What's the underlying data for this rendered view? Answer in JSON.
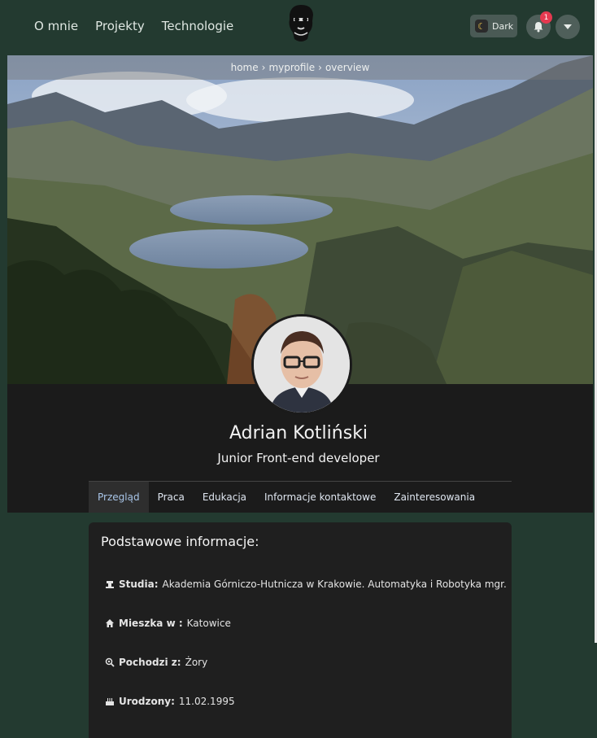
{
  "nav": {
    "links": [
      "O mnie",
      "Projekty",
      "Technologie"
    ],
    "theme_label": "Dark",
    "notification_count": "1"
  },
  "breadcrumb": [
    "home",
    "myprofile",
    "overview"
  ],
  "profile": {
    "name": "Adrian Kotliński",
    "role": "Junior Front-end developer"
  },
  "tabs": [
    "Przegląd",
    "Praca",
    "Edukacja",
    "Informacje kontaktowe",
    "Zainteresowania"
  ],
  "active_tab": "Przegląd",
  "info": {
    "title": "Podstawowe informacje:",
    "rows": [
      {
        "icon": "graduation-icon",
        "key": "Studia:",
        "value": "Akademia Górniczo-Hutnicza w Krakowie. Automatyka i Robotyka mgr."
      },
      {
        "icon": "home-icon",
        "key": "Mieszka w :",
        "value": "Katowice"
      },
      {
        "icon": "search-location-icon",
        "key": "Pochodzi z:",
        "value": "Żory"
      },
      {
        "icon": "birthday-cake-icon",
        "key": "Urodzony:",
        "value": "11.02.1995"
      }
    ]
  },
  "colors": {
    "nav_bg": "#233a30",
    "panel_bg": "#1b1b1b",
    "card_bg": "#1f1f1f",
    "accent_tab": "#a8c5e8",
    "badge": "#e53950"
  }
}
